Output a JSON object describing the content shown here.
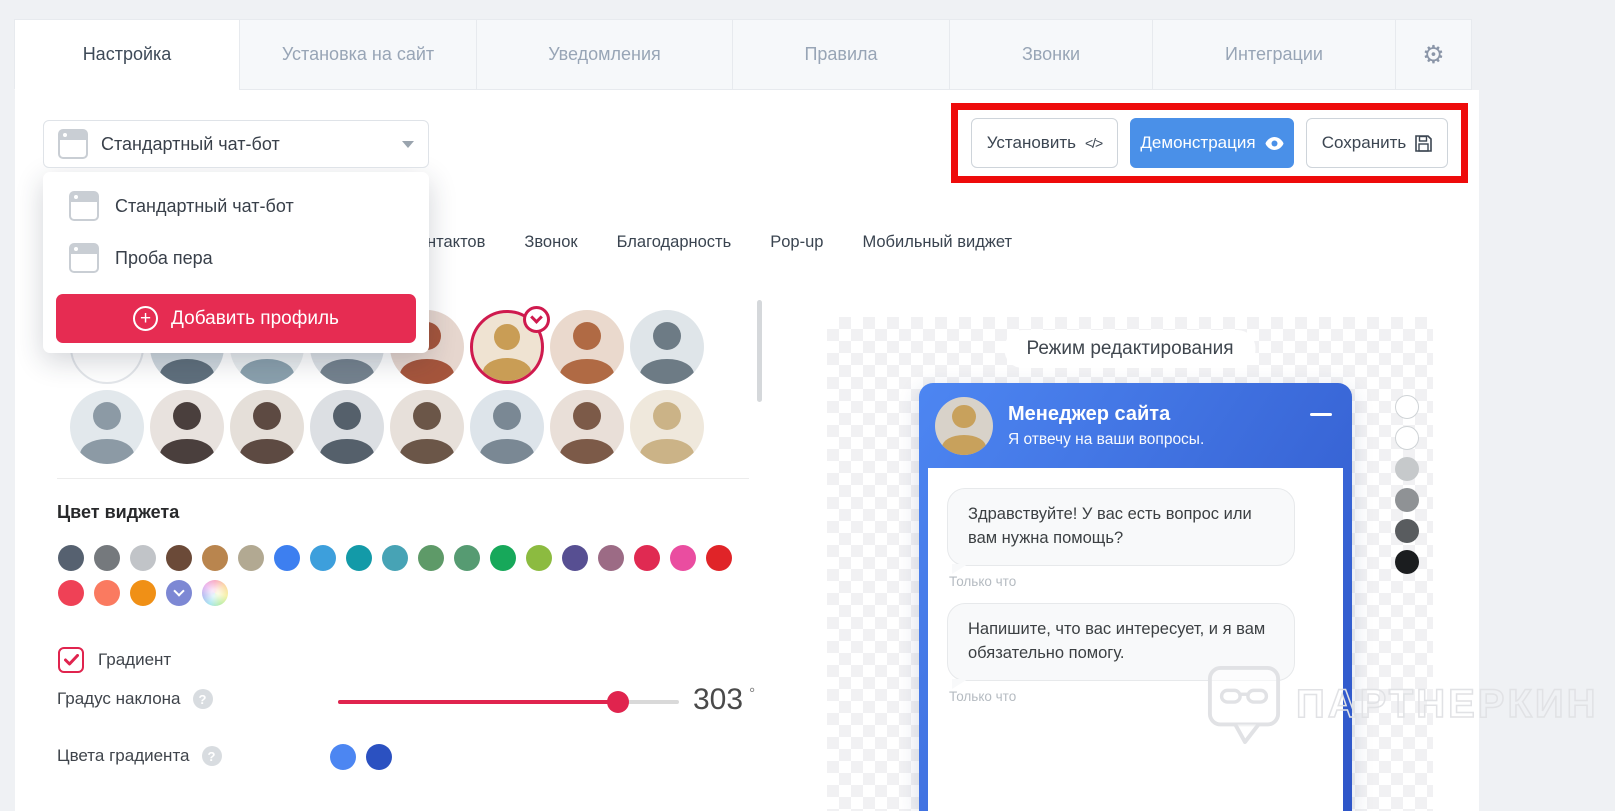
{
  "tabs": {
    "items": [
      {
        "label": "Настройка",
        "active": true
      },
      {
        "label": "Установка на сайт",
        "active": false
      },
      {
        "label": "Уведомления",
        "active": false
      },
      {
        "label": "Правила",
        "active": false
      },
      {
        "label": "Звонки",
        "active": false
      },
      {
        "label": "Интеграции",
        "active": false
      }
    ],
    "gear_icon": "⚙"
  },
  "profile": {
    "selected": "Стандартный чат-бот",
    "options": [
      "Стандартный чат-бот",
      "Проба пера"
    ],
    "add_label": "Добавить профиль",
    "plus_glyph": "+"
  },
  "actions": {
    "install": "Установить",
    "install_icon": "</>",
    "demo": "Демонстрация",
    "save": "Сохранить"
  },
  "subtabs": [
    "нтактов",
    "Звонок",
    "Благодарность",
    "Pop-up",
    "Мобильный виджет"
  ],
  "avatars": {
    "row1": [
      {
        "empty": true
      },
      {
        "bg": "#cfd8de",
        "fg": "#5f6f7c"
      },
      {
        "bg": "#e9edef",
        "fg": "#8aa0ad"
      },
      {
        "bg": "#dde2e6",
        "fg": "#74828e"
      },
      {
        "bg": "#e6d6ce",
        "fg": "#a5553c"
      },
      {
        "bg": "#efe3d2",
        "fg": "#c99d55",
        "selected": true
      },
      {
        "bg": "#ead9cd",
        "fg": "#b06a44"
      },
      {
        "bg": "#dfe5e9",
        "fg": "#6d7b85"
      }
    ],
    "row2": [
      {
        "bg": "#e2e8ec",
        "fg": "#8c9aa5"
      },
      {
        "bg": "#e8e2de",
        "fg": "#4a3f3d"
      },
      {
        "bg": "#e5dfd9",
        "fg": "#5d4a42"
      },
      {
        "bg": "#dcdfe3",
        "fg": "#55606b"
      },
      {
        "bg": "#e7e0da",
        "fg": "#6b5648"
      },
      {
        "bg": "#dde4ea",
        "fg": "#7a8894"
      },
      {
        "bg": "#e9dfd8",
        "fg": "#7c5a48"
      },
      {
        "bg": "#efe8dc",
        "fg": "#cbb387"
      }
    ]
  },
  "widget_color": {
    "label": "Цвет виджета",
    "row1": [
      "#566170",
      "#75797d",
      "#c1c4c8",
      "#6b4a38",
      "#b9854e",
      "#b2a992",
      "#3d7ff0",
      "#3d9fdc",
      "#139aa8",
      "#47a3b5",
      "#5e9a68",
      "#569b72",
      "#17a85a",
      "#8cbb40",
      "#574f92",
      "#9c6b85",
      "#e02a52",
      "#ea4da0",
      "#e02428"
    ],
    "row2": [
      "#ef4156",
      "#fa7a60",
      "#f09016",
      "#7d88d4",
      "rainbow"
    ],
    "selected_row2_index": 3
  },
  "gradient": {
    "label": "Градиент",
    "checked": true,
    "angle_label": "Градус наклона",
    "angle_value": "303",
    "angle_unit": "°",
    "angle_percent": 82,
    "colors_label": "Цвета градиента",
    "colors": [
      "#4c86f2",
      "#2b51c1"
    ]
  },
  "preview": {
    "title": "Режим редактирования",
    "chat": {
      "name": "Менеджер сайта",
      "status": "Я отвечу на ваши вопросы.",
      "avatar": {
        "bg": "#d8d2c9",
        "fg": "#c8a15c"
      },
      "header_gradient": [
        "#2e55c8",
        "#4d86f2"
      ],
      "messages": [
        {
          "text": "Здравствуйте! У вас есть вопрос или вам нужна помощь?",
          "time": "Только что"
        },
        {
          "text": "Напишите, что вас интересует, и я вам обязательно помогу.",
          "time": "Только что"
        }
      ]
    },
    "shade_dots": [
      "#ffffff",
      "#ffffff",
      "#c6c9cb",
      "#8f9295",
      "#595c5f",
      "#1b1d1f"
    ]
  },
  "watermark": {
    "text": "ПАРТНЕРКИН"
  },
  "colors": {
    "accent_red": "#e62c52",
    "demo_blue": "#4a90e8",
    "highlight_red": "#ee0b0b"
  }
}
